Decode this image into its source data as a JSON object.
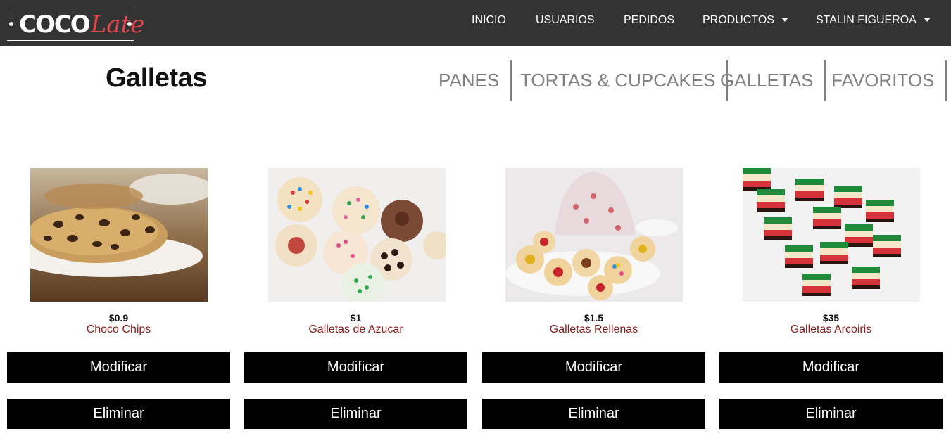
{
  "brand": {
    "part1": "COCO",
    "part2": "Late"
  },
  "nav": {
    "inicio": "INICIO",
    "usuarios": "USUARIOS",
    "pedidos": "PEDIDOS",
    "productos": "PRODUCTOS",
    "user": "STALIN FIGUEROA"
  },
  "page": {
    "title": "Galletas"
  },
  "categories": [
    "PANES",
    "TORTAS & CUPCAKES",
    "GALLETAS",
    "FAVORITOS"
  ],
  "products": [
    {
      "price": "$0.9",
      "name": "Choco Chips",
      "modify": "Modificar",
      "delete": "Eliminar",
      "image": "chocolate-chip-cookies-photo"
    },
    {
      "price": "$1",
      "name": "Galletas de Azucar",
      "modify": "Modificar",
      "delete": "Eliminar",
      "image": "sugar-cookies-photo"
    },
    {
      "price": "$1.5",
      "name": "Galletas Rellenas",
      "modify": "Modificar",
      "delete": "Eliminar",
      "image": "filled-cookies-photo"
    },
    {
      "price": "$35",
      "name": "Galletas Arcoiris",
      "modify": "Modificar",
      "delete": "Eliminar",
      "image": "rainbow-cookies-photo"
    }
  ],
  "colors": {
    "navbar": "#333333",
    "brand_accent": "#e0474c",
    "product_name": "#8b1a1a",
    "category_text": "#808080",
    "button": "#000000"
  }
}
